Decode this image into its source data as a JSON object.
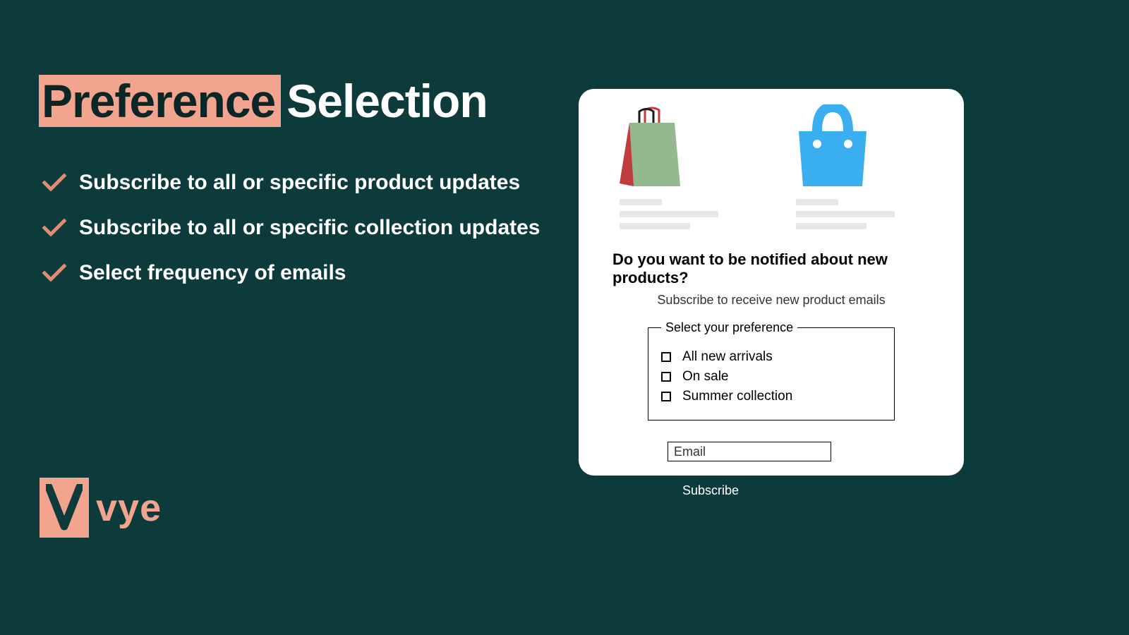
{
  "heading": {
    "highlight": "Preference",
    "rest": "Selection"
  },
  "bullets": [
    "Subscribe to all or specific product updates",
    "Subscribe to all or specific collection updates",
    "Select frequency of emails"
  ],
  "logo": {
    "text": "vye"
  },
  "form": {
    "heading": "Do you want to be notified about new products?",
    "subheading": "Subscribe to receive new product emails",
    "fieldset_legend": "Select your preference",
    "options": [
      "All new arrivals",
      "On sale",
      "Summer collection"
    ],
    "email_placeholder": "Email",
    "subscribe_label": "Subscribe"
  },
  "colors": {
    "accent": "#f2a48f",
    "bg": "#0d3b3b"
  }
}
